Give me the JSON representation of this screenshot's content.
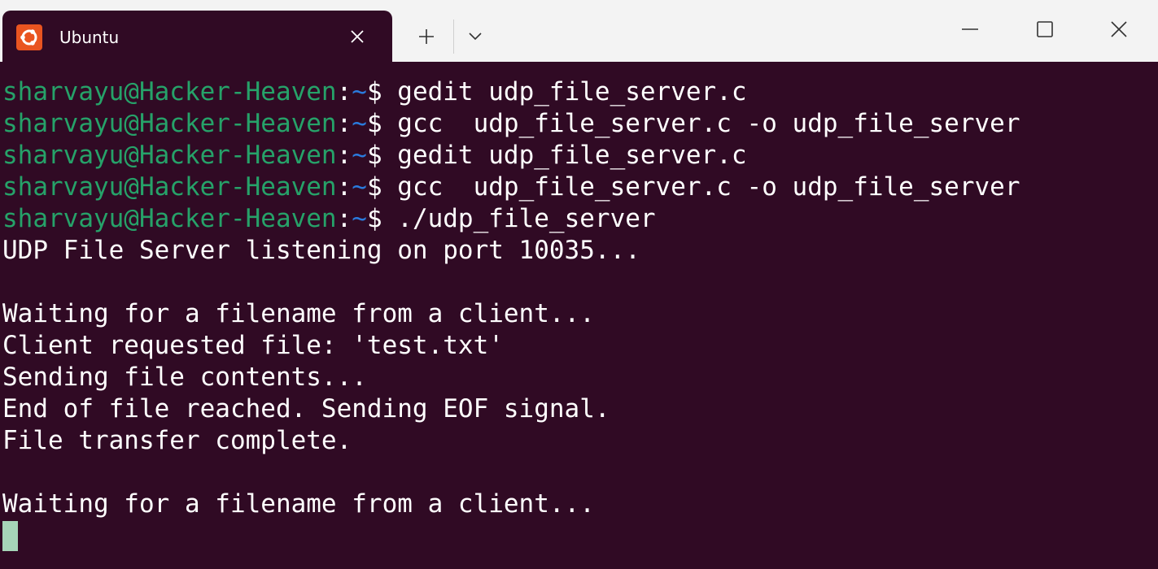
{
  "tab": {
    "title": "Ubuntu",
    "icon": "ubuntu-logo-icon",
    "icon_color": "#e95420"
  },
  "tabbar": {
    "new_tab_icon": "plus-icon",
    "dropdown_icon": "chevron-down-icon"
  },
  "window_controls": {
    "minimize_icon": "minimize-icon",
    "maximize_icon": "maximize-icon",
    "close_icon": "close-icon"
  },
  "colors": {
    "background": "#300a24",
    "prompt_user": "#26a269",
    "prompt_path": "#2a7bde",
    "text": "#ffffff",
    "cursor": "#a6d5b8"
  },
  "terminal": {
    "prompt": {
      "user_host": "sharvayu@Hacker-Heaven",
      "colon": ":",
      "path": "~",
      "sign": "$ "
    },
    "commands": [
      "gedit udp_file_server.c",
      "gcc  udp_file_server.c -o udp_file_server",
      "gedit udp_file_server.c",
      "gcc  udp_file_server.c -o udp_file_server",
      "./udp_file_server"
    ],
    "output": [
      "UDP File Server listening on port 10035...",
      "",
      "Waiting for a filename from a client...",
      "Client requested file: 'test.txt'",
      "Sending file contents...",
      "End of file reached. Sending EOF signal.",
      "File transfer complete.",
      "",
      "Waiting for a filename from a client..."
    ]
  }
}
